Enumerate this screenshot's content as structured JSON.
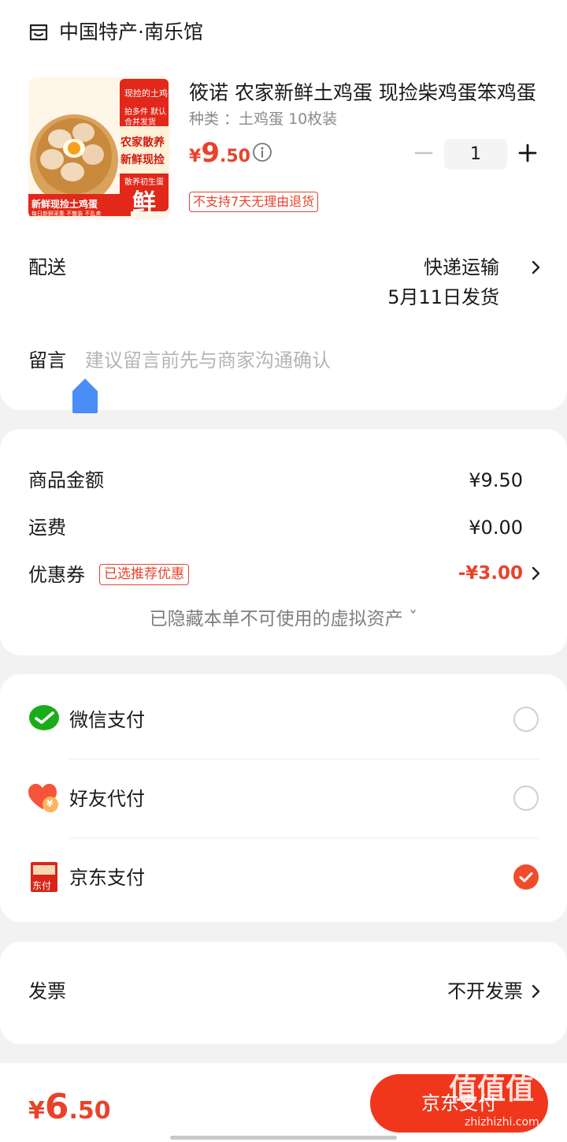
{
  "shop": {
    "name": "中国特产·南乐馆",
    "icon": "shop-icon"
  },
  "product": {
    "title": "筱诺  农家新鲜土鸡蛋  现捡柴鸡蛋笨鸡蛋",
    "spec": "种类 ：土鸡蛋  10枚装",
    "price": {
      "currency": "¥",
      "integer": "9",
      "decimal": ".50"
    },
    "quantity": "1",
    "return_policy": "不支持7天无理由退货",
    "image_text": {
      "top_ribbon": "现捡的土鸡蛋",
      "sub_note": "拍多件 默认合并发货",
      "box_line1": "农家散养",
      "box_line2": "新鲜现捡",
      "tag": "散养初生蛋",
      "big_char": "鲜",
      "bottom_banner": "新鲜现捡土鸡蛋",
      "bottom_fine": "每日新鲜采集 不散装 不乱卖"
    }
  },
  "delivery": {
    "label": "配送",
    "method": "快递运输",
    "date": "5月11日发货"
  },
  "message": {
    "label": "留言",
    "placeholder": "建议留言前先与商家沟通确认"
  },
  "fees": {
    "goods_label": "商品金额",
    "goods_value": "¥9.50",
    "shipping_label": "运费",
    "shipping_value": "¥0.00",
    "coupon_label": "优惠券",
    "coupon_badge": "已选推荐优惠",
    "coupon_value": "-¥3.00",
    "hidden_assets": "已隐藏本单不可使用的虚拟资产 ˇ"
  },
  "payment": {
    "options": [
      {
        "label": "微信支付",
        "icon": "wechat-pay-icon",
        "selected": false
      },
      {
        "label": "好友代付",
        "icon": "friend-pay-icon",
        "selected": false
      },
      {
        "label": "京东支付",
        "icon": "jd-pay-icon",
        "selected": true
      }
    ],
    "jd_icon_text": "东付",
    "friend_icon_text": "¥"
  },
  "invoice": {
    "label": "发票",
    "value": "不开发票"
  },
  "footer": {
    "total": {
      "currency": "¥",
      "integer": "6",
      "decimal": ".50"
    },
    "submit_label": "京东支付",
    "watermark": "值值值",
    "watermark_domain": "zhizhizhi.com"
  },
  "colors": {
    "accent": "#e8432a",
    "button": "#f0371c",
    "wechat": "#1aad19",
    "page_bg": "#f2f2f2"
  }
}
